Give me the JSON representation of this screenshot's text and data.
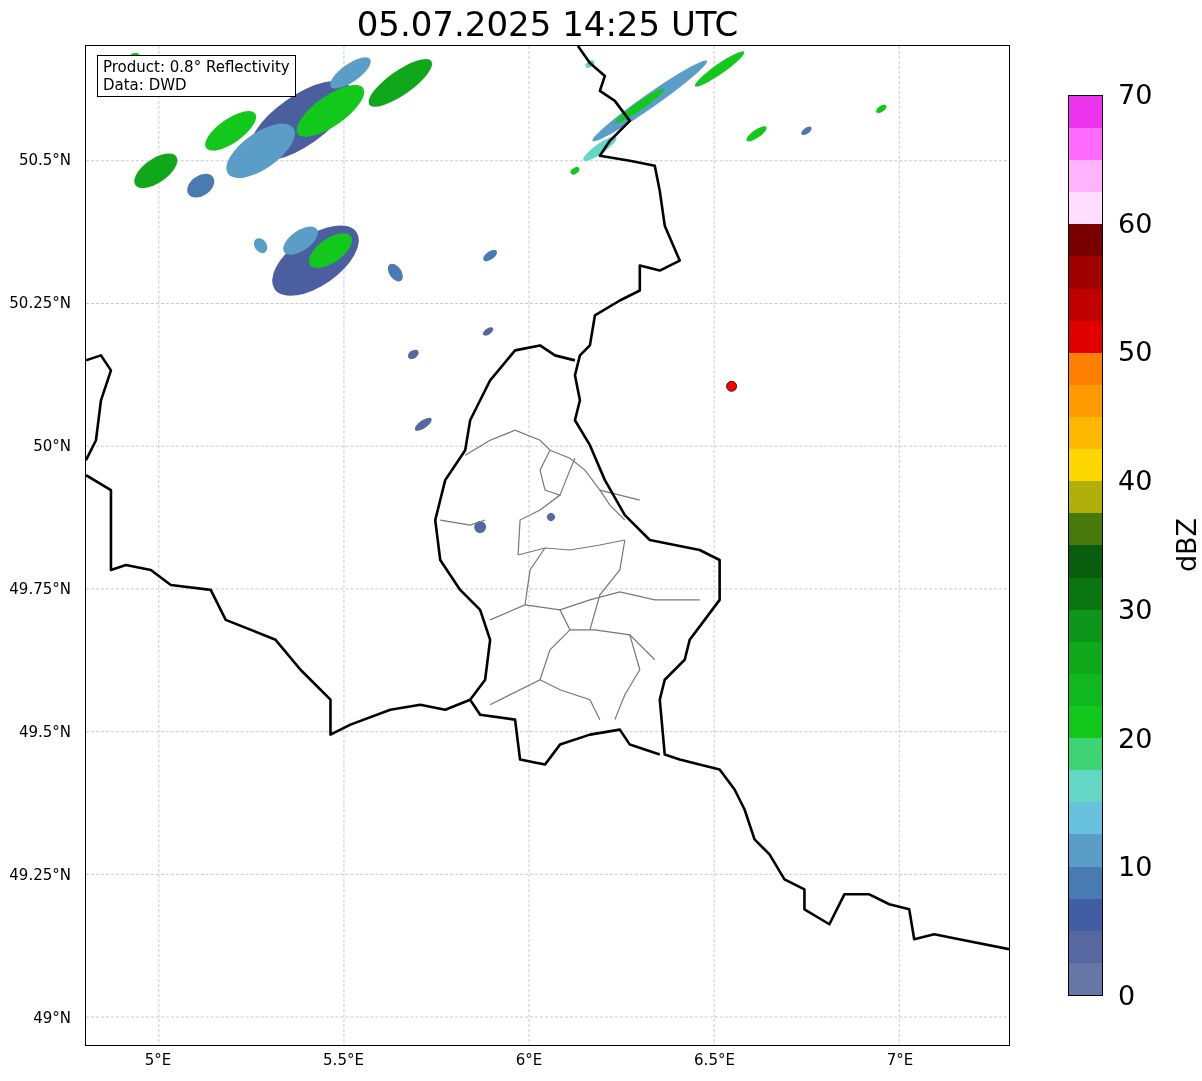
{
  "title": "05.07.2025 14:25 UTC",
  "info_box": [
    "Product: 0.8° Reflectivity",
    "Data: DWD"
  ],
  "y_ticks": [
    "50.5°N",
    "50.25°N",
    "50°N",
    "49.75°N",
    "49.5°N",
    "49.25°N",
    "49°N"
  ],
  "x_ticks": [
    "5°E",
    "5.5°E",
    "6°E",
    "6.5°E",
    "7°E"
  ],
  "colorbar": {
    "label": "dBZ",
    "ticks": [
      "70",
      "60",
      "50",
      "40",
      "30",
      "20",
      "10",
      "0"
    ],
    "segments": [
      {
        "color": "#6676a6"
      },
      {
        "color": "#5767a0"
      },
      {
        "color": "#415da3"
      },
      {
        "color": "#4a7ab2"
      },
      {
        "color": "#5a9ec8"
      },
      {
        "color": "#68c2dd"
      },
      {
        "color": "#63d6c4"
      },
      {
        "color": "#3dd573"
      },
      {
        "color": "#12c81b"
      },
      {
        "color": "#10b820"
      },
      {
        "color": "#0fa81a"
      },
      {
        "color": "#0d961a"
      },
      {
        "color": "#0b7512"
      },
      {
        "color": "#085e0e"
      },
      {
        "color": "#477a0a"
      },
      {
        "color": "#b0b00a"
      },
      {
        "color": "#ffd700"
      },
      {
        "color": "#ffb800"
      },
      {
        "color": "#ff9b00"
      },
      {
        "color": "#ff7f00"
      },
      {
        "color": "#e00000"
      },
      {
        "color": "#c00000"
      },
      {
        "color": "#a00000"
      },
      {
        "color": "#7a0000"
      },
      {
        "color": "#ffddff"
      },
      {
        "color": "#ffb3ff"
      },
      {
        "color": "#ff6aff"
      },
      {
        "color": "#ee33ee"
      }
    ]
  }
}
